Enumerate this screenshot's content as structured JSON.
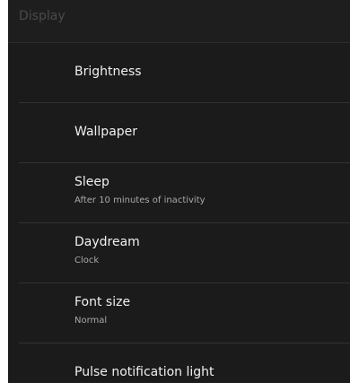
{
  "header": {
    "title": "Display"
  },
  "settings": {
    "items": [
      {
        "title": "Brightness"
      },
      {
        "title": "Wallpaper"
      },
      {
        "title": "Sleep",
        "subtitle": "After 10 minutes of inactivity"
      },
      {
        "title": "Daydream",
        "subtitle": "Clock"
      },
      {
        "title": "Font size",
        "subtitle": "Normal"
      },
      {
        "title": "Pulse notification light"
      }
    ]
  },
  "colors": {
    "background": "#1b1b1c",
    "divider": "#323234",
    "title_text": "#f0f0f0",
    "subtitle_text": "#a9a9ab",
    "header_text": "#4a4a4c"
  }
}
